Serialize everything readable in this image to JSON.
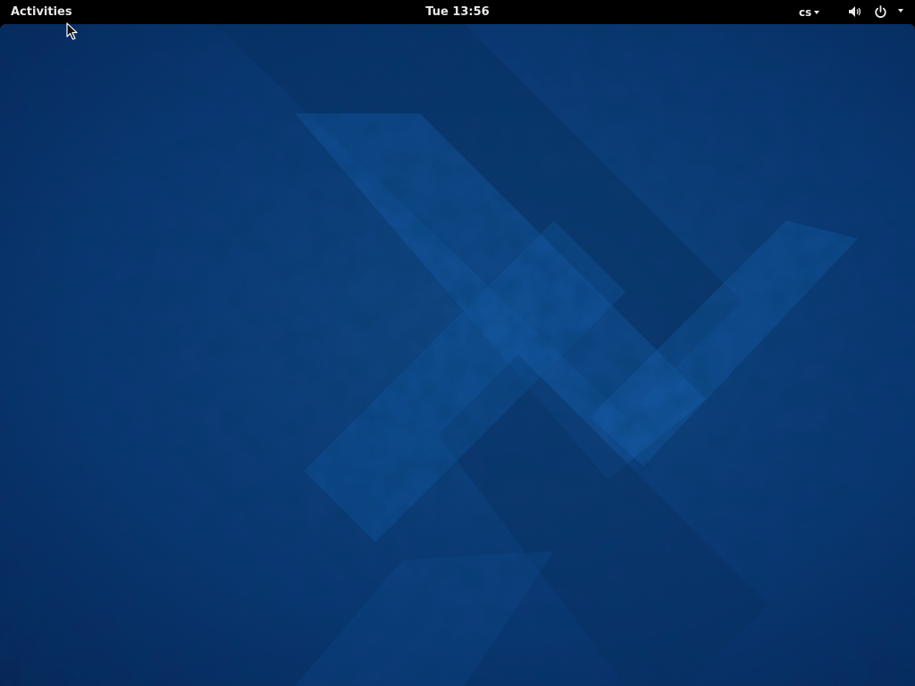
{
  "top_bar": {
    "activities_label": "Activities",
    "clock": "Tue 13:56",
    "keyboard_layout": "cs",
    "status_icons": [
      "volume-icon",
      "power-icon",
      "chevron-down-icon"
    ]
  },
  "desktop": {
    "wallpaper": "blue-geometric",
    "colors": {
      "panel": "#000000",
      "panel_text": "#e8e8e8",
      "wallpaper_dark": "#0a2a5e",
      "wallpaper_mid": "#0f4a8c",
      "wallpaper_light": "#1565b5"
    }
  }
}
